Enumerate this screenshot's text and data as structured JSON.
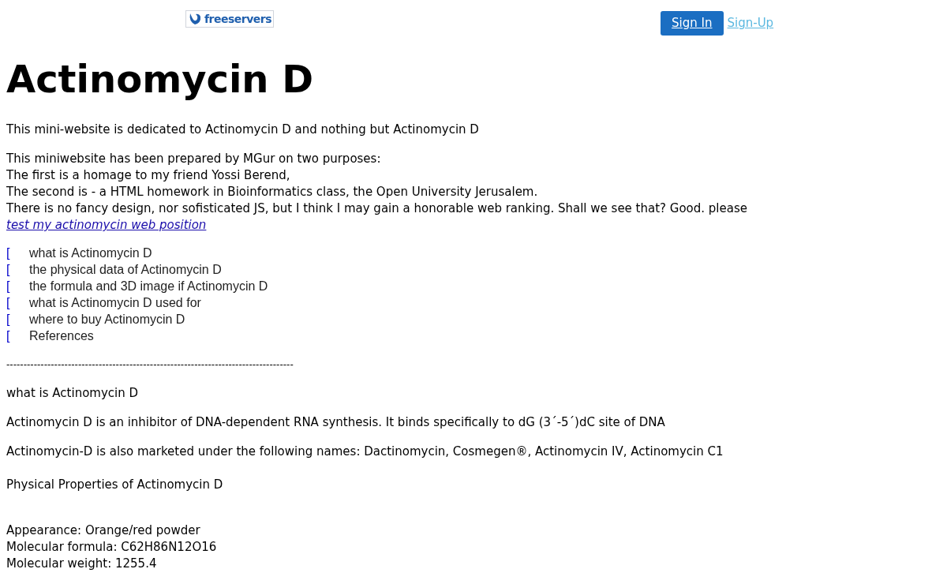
{
  "header": {
    "logo_text": "freeservers",
    "sign_in": "Sign In",
    "sign_up": "Sign-Up"
  },
  "title": "Actinomycin D",
  "intro": "This mini-website is dedicated to Actinomycin D and nothing but Actinomycin D",
  "purpose_lines": [
    "This miniwebsite has been prepared by MGur on two purposes:",
    "The first is a homage to my friend Yossi Berend,",
    "The second is - a HTML homework in  Bioinformatics class, the Open University Jerusalem."
  ],
  "purpose_last": {
    "text": "There is no fancy design, nor sofisticated JS, but I think I may gain a honorable web ranking. Shall we see that? Good. please ",
    "link": "test my actinomycin web position"
  },
  "toc": [
    {
      "marker": "[",
      "label": "what is Actinomycin D"
    },
    {
      "marker": "[",
      "label": "the physical data of Actinomycin D"
    },
    {
      "marker": "[",
      "label": "the formula and 3D image if Actinomycin D"
    },
    {
      "marker": "[",
      "label": "what is Actinomycin D used for"
    },
    {
      "marker": "[",
      "label": "where to buy Actinomycin D"
    },
    {
      "marker": "[",
      "label": "References"
    }
  ],
  "divider": "------------------------------------------------------------------------------------",
  "section_heading": "what is Actinomycin D",
  "paragraphs": [
    "Actinomycin D is an inhibitor of DNA-dependent RNA synthesis. It binds specifically to dG (3´-5´)dC site of DNA",
    "Actinomycin-D is also marketed under the following names: Dactinomycin, Cosmegen®, Actinomycin IV, Actinomycin C1"
  ],
  "physical_heading": "Physical Properties of Actinomycin D",
  "properties": [
    "Appearance: Orange/red powder",
    "Molecular formula: C62H86N12O16",
    "Molecular weight: 1255.4"
  ]
}
